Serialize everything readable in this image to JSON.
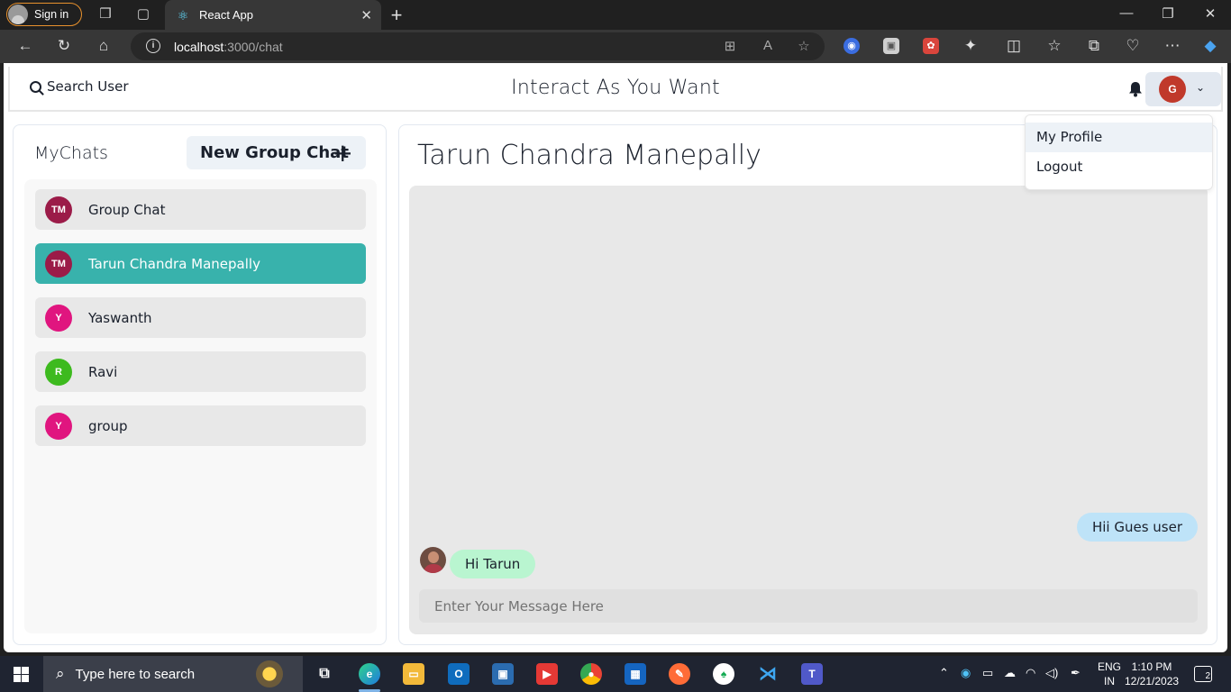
{
  "browser": {
    "signin_label": "Sign in",
    "tab_title": "React App",
    "url_host": "localhost",
    "url_path": ":3000/chat"
  },
  "app": {
    "search_label": "Search User",
    "title": "Interact As You Want",
    "user_initial": "G",
    "menu": [
      "My Profile",
      "Logout"
    ]
  },
  "chats": {
    "header": "MyChats",
    "new_group_label": "New Group Chat",
    "items": [
      {
        "initials": "TM",
        "name": "Group Chat",
        "avatar_color": "#9b1b48",
        "active": false
      },
      {
        "initials": "TM",
        "name": "Tarun Chandra Manepally",
        "avatar_color": "#9b1b48",
        "active": true
      },
      {
        "initials": "Y",
        "name": "Yaswanth",
        "avatar_color": "#e0157f",
        "active": false
      },
      {
        "initials": "R",
        "name": "Ravi",
        "avatar_color": "#3dba1e",
        "active": false
      },
      {
        "initials": "Y",
        "name": "group",
        "avatar_color": "#e0157f",
        "active": false
      }
    ]
  },
  "conversation": {
    "title": "Tarun Chandra Manepally",
    "messages": [
      {
        "text": "Hii Gues user",
        "direction": "out"
      },
      {
        "text": "Hi Tarun",
        "direction": "in"
      }
    ],
    "input_placeholder": "Enter Your Message Here"
  },
  "taskbar": {
    "search_placeholder": "Type here to search",
    "lang_line1": "ENG",
    "lang_line2": "IN",
    "time": "1:10 PM",
    "date": "12/21/2023",
    "notification_count": "2"
  },
  "colors": {
    "accent_teal": "#38b2ac",
    "bubble_out": "#bee3f8",
    "bubble_in": "#b9f5d0"
  }
}
